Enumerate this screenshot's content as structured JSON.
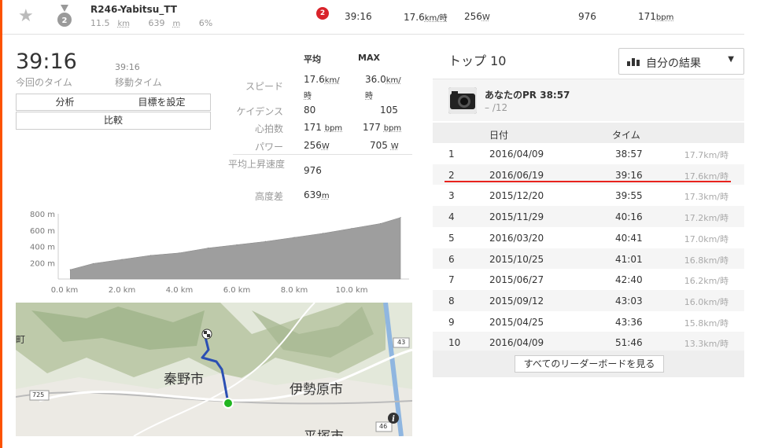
{
  "header": {
    "segment_name": "R246-Yabitsu_TT",
    "distance": "11.5",
    "distance_unit": "km",
    "elevation": "639",
    "elevation_unit": "m",
    "grade": "6%",
    "rank_badge": "2",
    "medal_number": "2",
    "time": "39:16",
    "speed": "17.6",
    "speed_unit": "km/時",
    "power": "256",
    "power_unit": "W",
    "vam": "976",
    "heart_rate": "171",
    "hr_unit": "bpm"
  },
  "effort": {
    "elapsed_time": "39:16",
    "elapsed_label": "今回のタイム",
    "moving_time": "39:16",
    "moving_label": "移動タイム",
    "btn_analysis": "分析",
    "btn_goal": "目標を設定",
    "btn_compare": "比較"
  },
  "stats": {
    "col_avg": "平均",
    "col_max": "MAX",
    "rows": [
      {
        "label": "スピード",
        "avg": "17.6",
        "avg_unit": "km/時",
        "max": "36.0",
        "max_unit": "km/時"
      },
      {
        "label": "ケイデンス",
        "avg": "80",
        "avg_unit": "",
        "max": "105",
        "max_unit": ""
      },
      {
        "label": "心拍数",
        "avg": "171",
        "avg_unit": "bpm",
        "max": "177",
        "max_unit": "bpm"
      },
      {
        "label": "パワー",
        "avg": "256",
        "avg_unit": "W",
        "max": "705",
        "max_unit": "W"
      }
    ],
    "vam_label": "平均上昇速度",
    "vam_value": "976",
    "elev_label": "高度差",
    "elev_value": "639",
    "elev_unit": "m"
  },
  "chart_data": {
    "type": "area",
    "x": [
      0.2,
      1,
      2,
      3,
      4,
      5,
      6,
      7,
      8,
      9,
      10,
      11,
      11.7
    ],
    "y": [
      115,
      190,
      240,
      290,
      320,
      380,
      420,
      460,
      510,
      560,
      620,
      680,
      754
    ],
    "xlim": [
      0,
      12.0
    ],
    "ylim": [
      0,
      800
    ],
    "x_ticks": [
      "0.0 km",
      "2.0 km",
      "4.0 km",
      "6.0 km",
      "8.0 km",
      "10.0 km"
    ],
    "y_ticks": [
      "200 m",
      "400 m",
      "600 m",
      "800 m"
    ],
    "title": "",
    "xlabel": "",
    "ylabel": "",
    "fill_color": "#9e9e9e"
  },
  "map": {
    "label_hadano": "秦野市",
    "label_isehara": "伊勢原市",
    "label_hiratsuka": "平塚市",
    "route_725": "725",
    "route_43": "43",
    "route_46": "46",
    "partial_left": "町",
    "route_color": "#2b4fb3",
    "start_color": "#21b521"
  },
  "leaderboard": {
    "title": "トップ 10",
    "filter_label": "自分の結果",
    "pr_title": "あなたのPR 38:57",
    "pr_sub": "– /12",
    "col_date": "日付",
    "col_time": "タイム",
    "rows": [
      {
        "rank": "1",
        "date": "2016/04/09",
        "time": "38:57",
        "speed": "17.7km/時"
      },
      {
        "rank": "2",
        "date": "2016/06/19",
        "time": "39:16",
        "speed": "17.6km/時"
      },
      {
        "rank": "3",
        "date": "2015/12/20",
        "time": "39:55",
        "speed": "17.3km/時"
      },
      {
        "rank": "4",
        "date": "2015/11/29",
        "time": "40:16",
        "speed": "17.2km/時"
      },
      {
        "rank": "5",
        "date": "2016/03/20",
        "time": "40:41",
        "speed": "17.0km/時"
      },
      {
        "rank": "6",
        "date": "2015/10/25",
        "time": "41:01",
        "speed": "16.8km/時"
      },
      {
        "rank": "7",
        "date": "2015/06/27",
        "time": "42:40",
        "speed": "16.2km/時"
      },
      {
        "rank": "8",
        "date": "2015/09/12",
        "time": "43:03",
        "speed": "16.0km/時"
      },
      {
        "rank": "9",
        "date": "2015/04/25",
        "time": "43:36",
        "speed": "15.8km/時"
      },
      {
        "rank": "10",
        "date": "2016/04/09",
        "time": "51:46",
        "speed": "13.3km/時"
      }
    ],
    "view_all": "すべてのリーダーボードを見る"
  }
}
